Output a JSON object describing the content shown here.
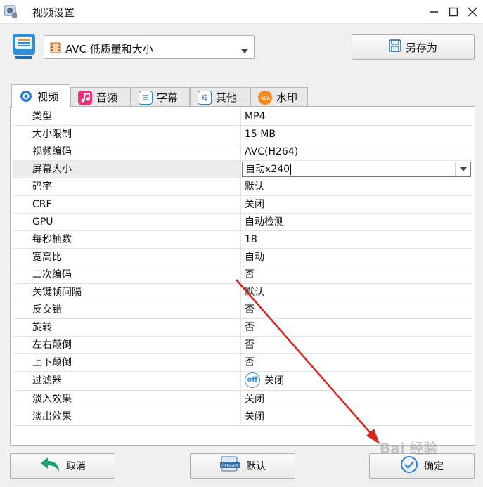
{
  "window": {
    "title": "视频设置"
  },
  "preset": {
    "value": "AVC 低质量和大小",
    "save_as_label": "另存为"
  },
  "tabs": [
    {
      "label": "视频",
      "icon": "video-icon",
      "color": "#2f7fd6"
    },
    {
      "label": "音频",
      "icon": "music-icon",
      "color": "#e8337a"
    },
    {
      "label": "字幕",
      "icon": "subtitle-icon",
      "color": "#2f8fb6"
    },
    {
      "label": "其他",
      "icon": "sliders-icon",
      "color": "#4a7aa8"
    },
    {
      "label": "水印",
      "icon": "watermark-icon",
      "color": "#f28a1e"
    }
  ],
  "properties": [
    {
      "key": "类型",
      "value": "MP4"
    },
    {
      "key": "大小限制",
      "value": "15 MB"
    },
    {
      "key": "视频编码",
      "value": "AVC(H264)"
    },
    {
      "key": "屏幕大小",
      "value": "自动x240"
    },
    {
      "key": "码率",
      "value": "默认"
    },
    {
      "key": "CRF",
      "value": "关闭"
    },
    {
      "key": "GPU",
      "value": "自动检测"
    },
    {
      "key": "每秒桢数",
      "value": "18"
    },
    {
      "key": "宽高比",
      "value": "自动"
    },
    {
      "key": "二次编码",
      "value": "否"
    },
    {
      "key": "关键帧间隔",
      "value": "默认"
    },
    {
      "key": "反交错",
      "value": "否"
    },
    {
      "key": "旋转",
      "value": "否"
    },
    {
      "key": "左右颠倒",
      "value": "否"
    },
    {
      "key": "上下颠倒",
      "value": "否"
    },
    {
      "key": "过滤器",
      "value": "关闭",
      "toggle_label": "off"
    },
    {
      "key": "淡入效果",
      "value": "关闭"
    },
    {
      "key": "淡出效果",
      "value": "关闭"
    }
  ],
  "buttons": {
    "cancel": "取消",
    "default": "默认",
    "default_icon_text": "DEFAULT",
    "ok": "确定"
  },
  "watermark": "Bai 经验",
  "colors": {
    "accent": "#2f7fd6",
    "annotation_arrow": "#d9261c"
  }
}
